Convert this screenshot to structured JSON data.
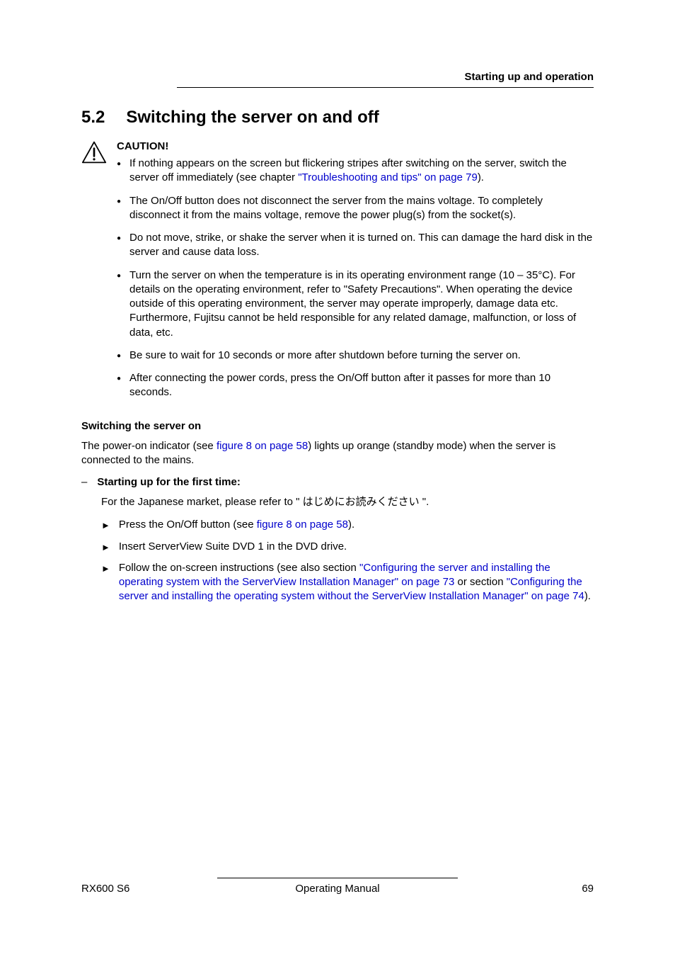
{
  "header": {
    "running_title": "Starting up and operation"
  },
  "section": {
    "number": "5.2",
    "title": "Switching the server on and off"
  },
  "caution": {
    "label": "CAUTION!",
    "items": [
      {
        "pre": "If nothing appears on the screen but flickering stripes after switching on the server, switch the server off immediately (see chapter ",
        "link": "\"Troubleshooting and tips\" on page 79",
        "post": ")."
      },
      {
        "text": "The On/Off button does not disconnect the server from the mains voltage. To completely disconnect it from the mains voltage, remove the power plug(s) from the socket(s)."
      },
      {
        "text": "Do not move, strike, or shake the server when it is turned on. This can damage the hard disk in the server and cause data loss."
      },
      {
        "text": "Turn the server on when the temperature is in its operating environment range (10 – 35°C). For details on the operating environment, refer to \"Safety Precautions\". When operating the device outside of this operating environment, the server may operate improperly, damage data etc. Furthermore, Fujitsu cannot be held responsible for any related damage, malfunction, or loss of data, etc."
      },
      {
        "text": "Be sure to wait for 10 seconds or more after shutdown before turning the server on."
      },
      {
        "text": "After connecting the power cords, press the On/Off button after it passes for more than 10 seconds."
      }
    ]
  },
  "switching_on": {
    "heading": "Switching the server on",
    "para_pre": "The power-on indicator (see ",
    "para_link": "figure 8 on page 58",
    "para_post": ") lights up orange (standby mode) when the server is connected to the mains.",
    "first_time_label": "Starting up for the first time:",
    "jp_note": "For the Japanese market, please refer to \" はじめにお読みください \".",
    "steps": [
      {
        "pre": "Press the On/Off button (see ",
        "link": "figure 8 on page 58",
        "post": ")."
      },
      {
        "text": "Insert ServerView Suite DVD 1 in the DVD drive."
      },
      {
        "pre": "Follow the on-screen instructions (see also section ",
        "link1": "\"Configuring the server and installing the operating system with the ServerView Installation Manager\" on page 73",
        "mid": " or section ",
        "link2": "\"Configuring the server and installing the operating system without the ServerView Installation Manager\" on page 74",
        "post": ")."
      }
    ]
  },
  "footer": {
    "left": "RX600 S6",
    "center": "Operating Manual",
    "right": "69"
  }
}
